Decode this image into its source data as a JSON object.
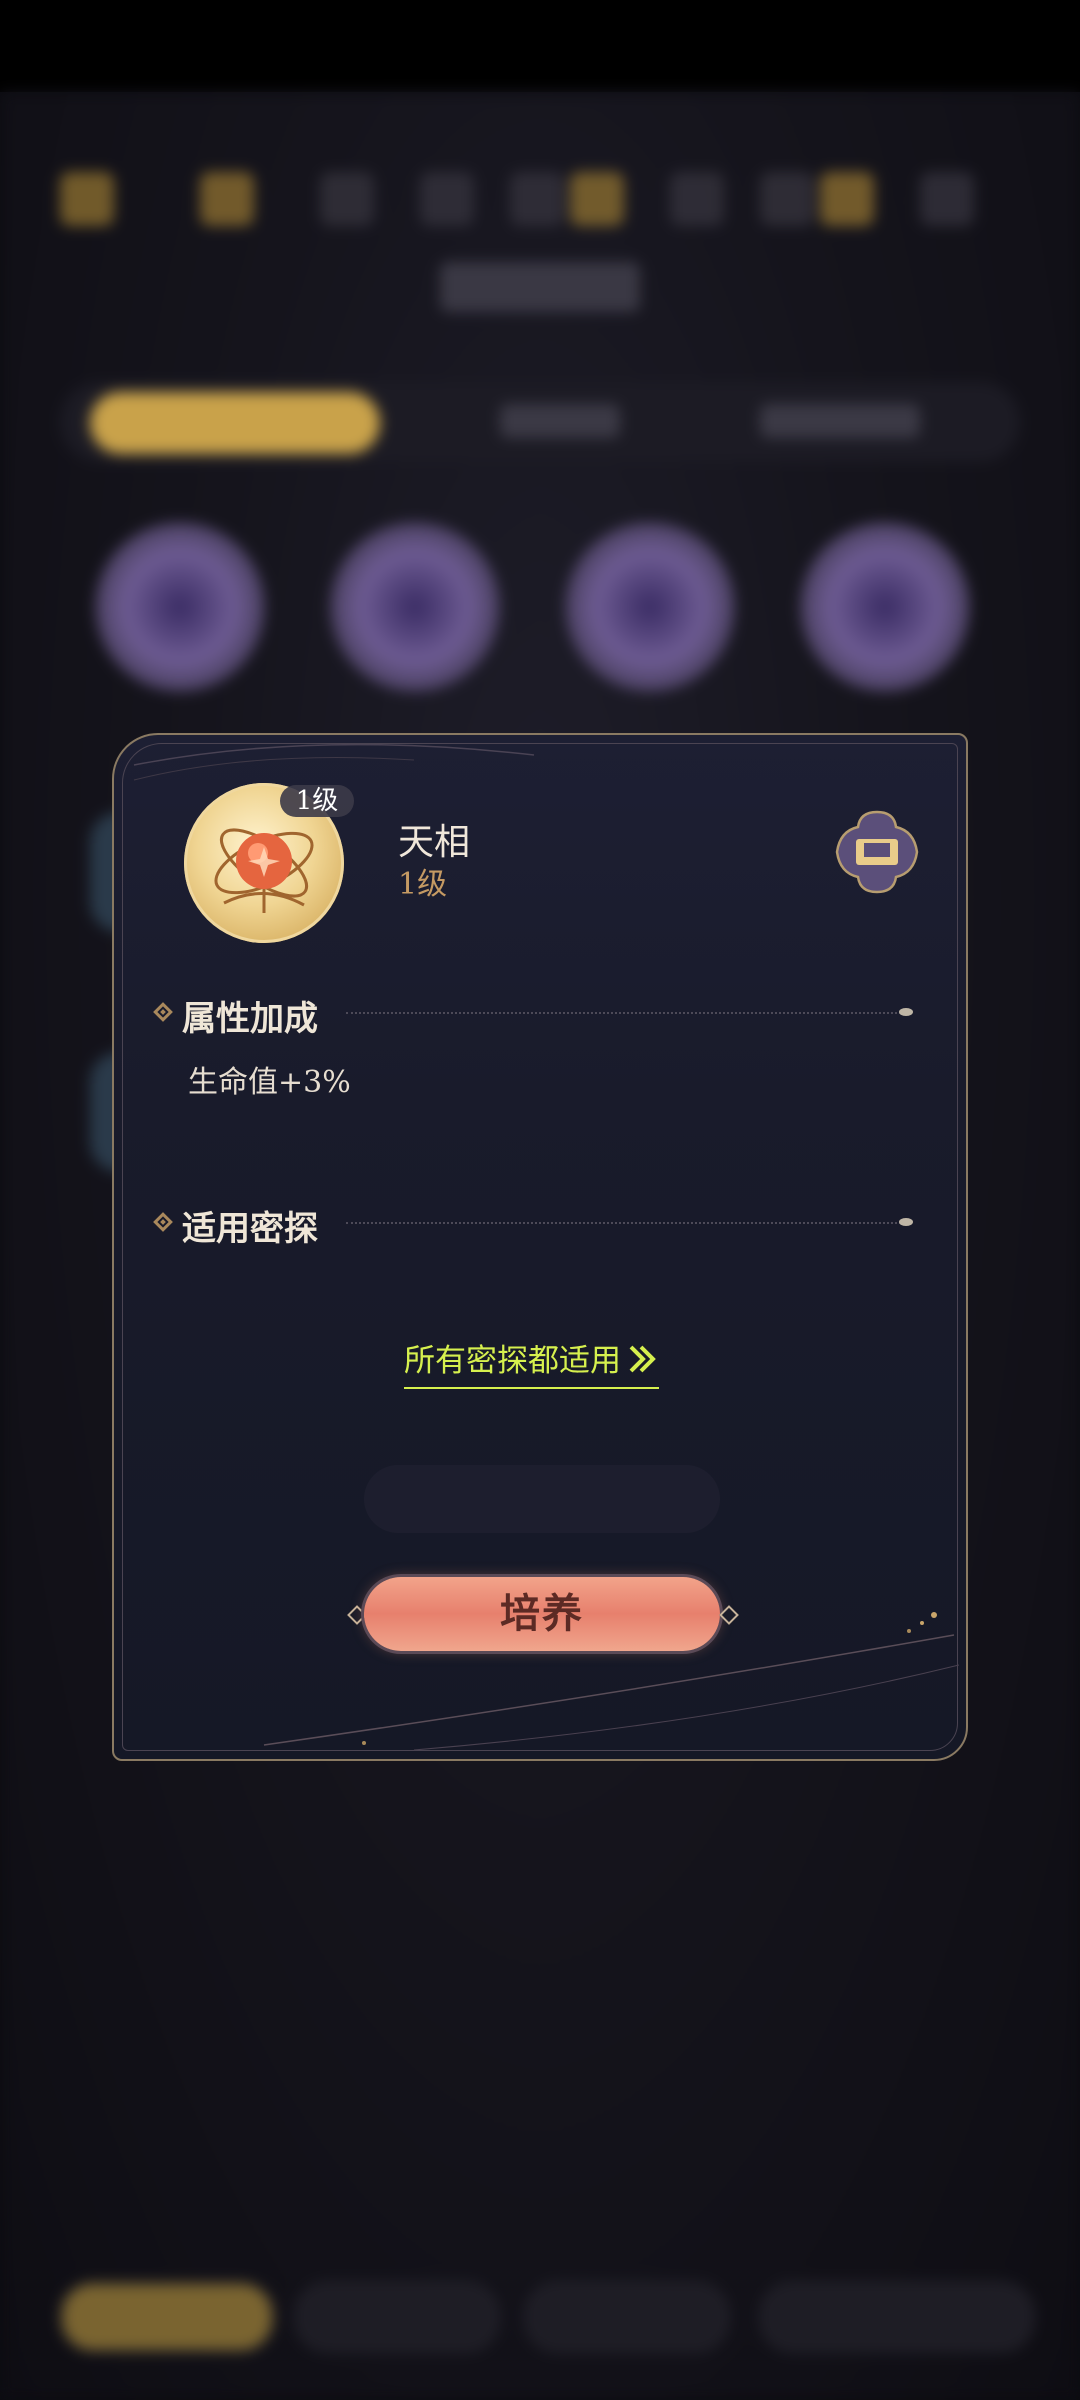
{
  "item": {
    "name": "天相",
    "level": "1级",
    "badge": "1级",
    "medal_icon": "astrolabe-icon"
  },
  "sections": {
    "attributes": {
      "title": "属性加成",
      "values": [
        "生命值+3%"
      ]
    },
    "applicable": {
      "title": "适用密探",
      "link_text": "所有密探都适用",
      "link_icon": "double-chevron-right-icon"
    }
  },
  "actions": {
    "lock_icon": "lock-icon",
    "cultivate_label": "培养"
  },
  "colors": {
    "accent_link": "#d6f04e",
    "level_text": "#c59a63",
    "button_fill": "#e7806d",
    "panel_border": "#8a7a62"
  }
}
